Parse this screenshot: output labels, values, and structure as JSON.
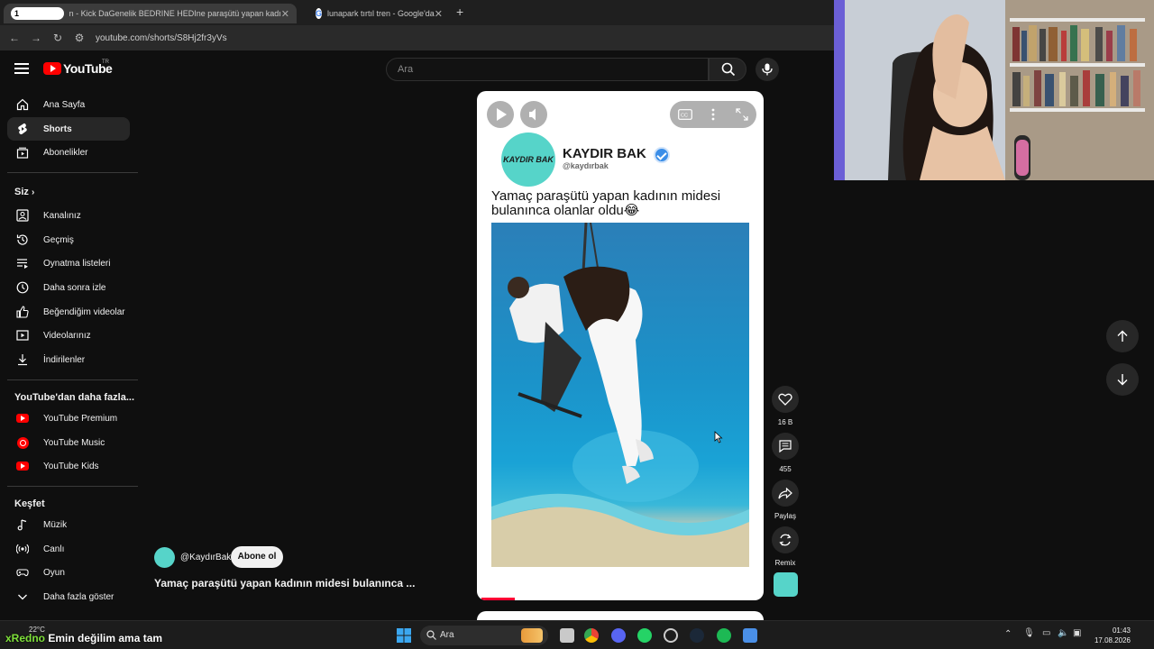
{
  "browser": {
    "tabs": [
      {
        "label": "n - Kick DaGenelik BEDRINE HEDIne paraşütü yapan kadı",
        "badge": "1",
        "active": true
      },
      {
        "label": "lunapark tırtıl tren - Google'da",
        "active": false
      }
    ],
    "url": "youtube.com/shorts/S8Hj2fr3yVs"
  },
  "header": {
    "logo": "YouTube",
    "logo_region": "TR",
    "search_placeholder": "Ara"
  },
  "sidebar": {
    "main": [
      {
        "label": "Ana Sayfa",
        "icon": "home-icon"
      },
      {
        "label": "Shorts",
        "icon": "shorts-icon",
        "active": true
      },
      {
        "label": "Abonelikler",
        "icon": "subscriptions-icon"
      }
    ],
    "you_heading": "Siz",
    "you": [
      {
        "label": "Kanalınız",
        "icon": "channel-icon"
      },
      {
        "label": "Geçmiş",
        "icon": "history-icon"
      },
      {
        "label": "Oynatma listeleri",
        "icon": "playlists-icon"
      },
      {
        "label": "Daha sonra izle",
        "icon": "watch-later-icon"
      },
      {
        "label": "Beğendiğim videolar",
        "icon": "liked-icon"
      },
      {
        "label": "Videolarınız",
        "icon": "your-videos-icon"
      },
      {
        "label": "İndirilenler",
        "icon": "downloads-icon"
      }
    ],
    "more_heading": "YouTube'dan daha fazla...",
    "more": [
      {
        "label": "YouTube Premium",
        "icon": "youtube-premium-icon"
      },
      {
        "label": "YouTube Music",
        "icon": "youtube-music-icon"
      },
      {
        "label": "YouTube Kids",
        "icon": "youtube-kids-icon"
      }
    ],
    "explore_heading": "Keşfet",
    "explore": [
      {
        "label": "Müzik",
        "icon": "music-icon"
      },
      {
        "label": "Canlı",
        "icon": "live-icon"
      },
      {
        "label": "Oyun",
        "icon": "gaming-icon"
      },
      {
        "label": "Daha fazla göster",
        "icon": "chevron-down-icon"
      }
    ]
  },
  "short": {
    "channel_name": "KAYDIR BAK",
    "channel_handle": "@kaydırbak",
    "logo_text": "KAYDIR BAK",
    "caption": "Yamaç paraşütü yapan kadının midesi bulanınca olanlar oldu😂",
    "progress_percent": 12
  },
  "actions": {
    "like_count": "16 B",
    "comment_count": "455",
    "share_label": "Paylaş",
    "remix_label": "Remix"
  },
  "meta": {
    "handle": "@KaydırBak",
    "subscribe_label": "Abone ol",
    "title": "Yamaç paraşütü yapan kadının midesi bulanınca ..."
  },
  "taskbar": {
    "search_label": "Ara",
    "weather": "22°C",
    "time": "01:43",
    "date": "17.08.2026"
  },
  "overlay": {
    "name": "xRedno",
    "message": "Emin değilim ama tam"
  }
}
